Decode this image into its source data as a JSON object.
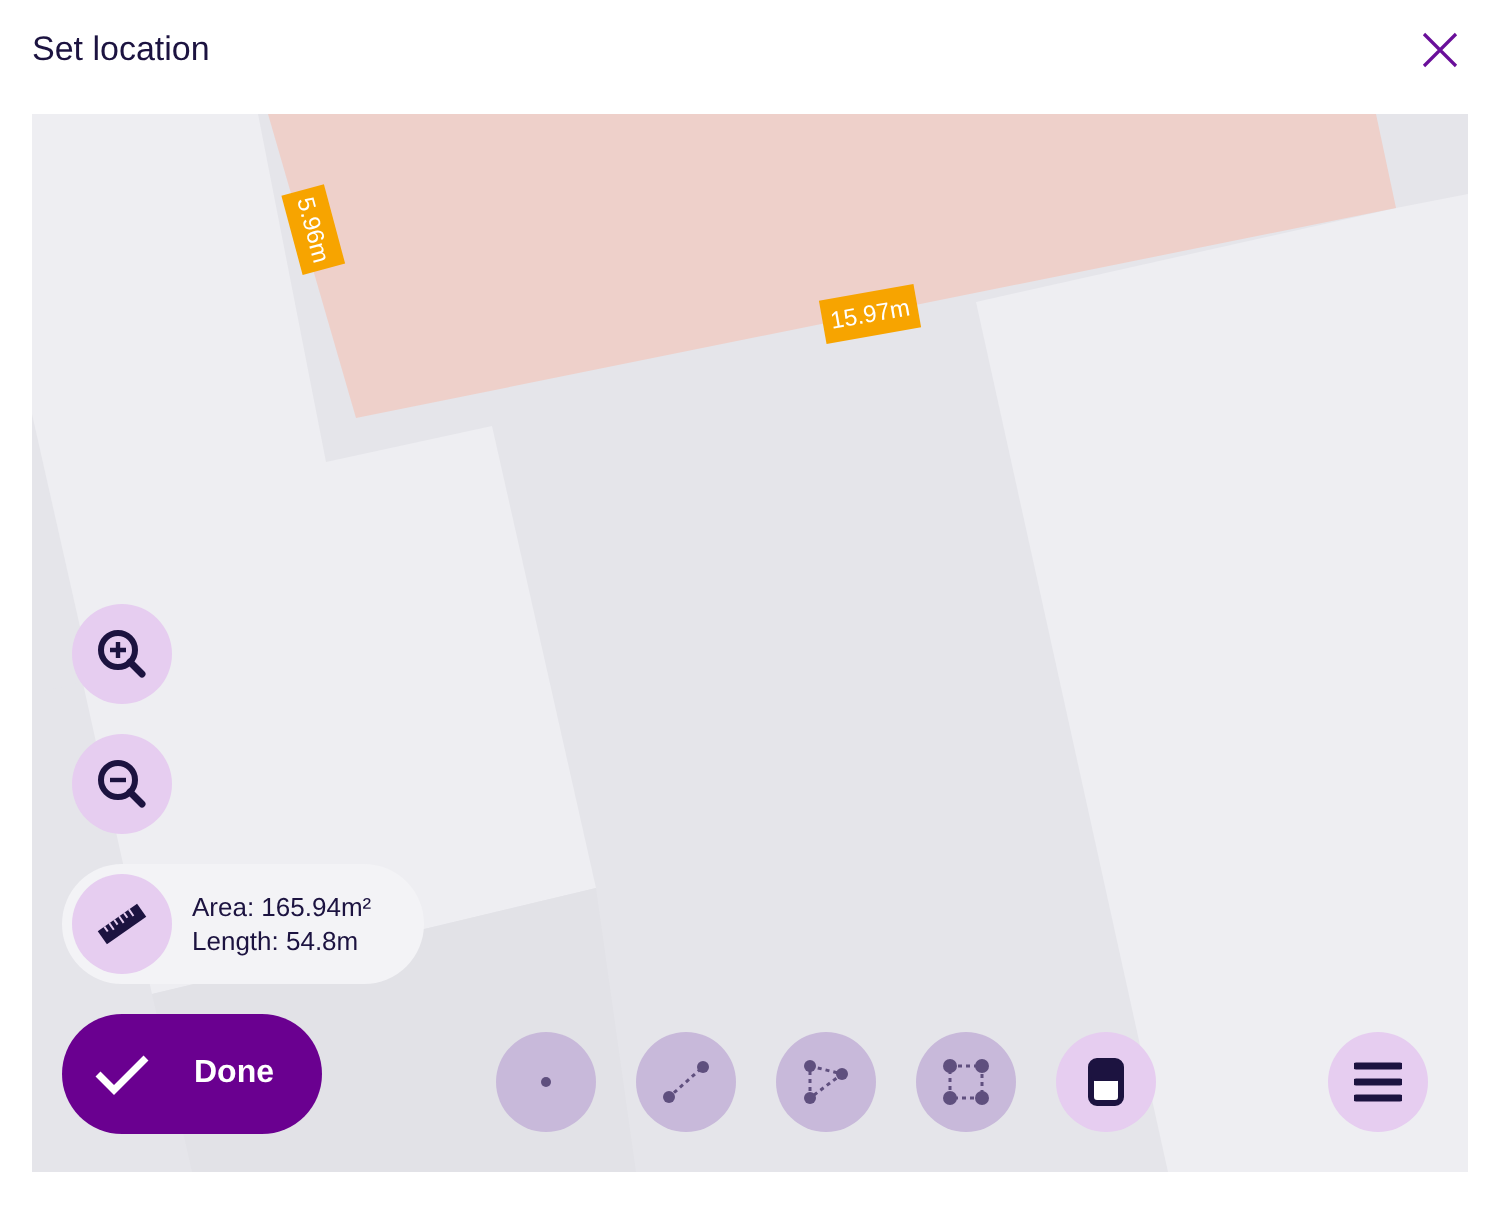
{
  "dialog": {
    "title": "Set location"
  },
  "map": {
    "edge_labels": [
      {
        "text": "5.96m",
        "kind": "side"
      },
      {
        "text": "15.97m",
        "kind": "bottom"
      }
    ],
    "measurement": {
      "area": "Area: 165.94m²",
      "length": "Length: 54.8m"
    },
    "done_button": {
      "label": "Done"
    },
    "tools": [
      {
        "kind": "point",
        "disabled": true
      },
      {
        "kind": "line",
        "disabled": true
      },
      {
        "kind": "polygon",
        "disabled": true
      },
      {
        "kind": "rectangle",
        "disabled": true
      },
      {
        "kind": "layer",
        "disabled": false
      }
    ]
  }
}
